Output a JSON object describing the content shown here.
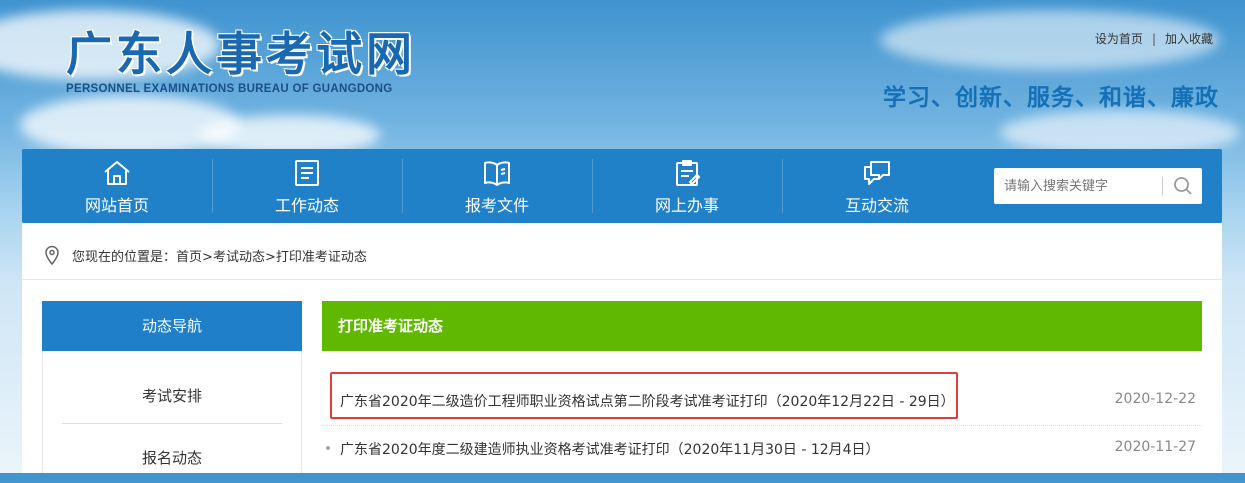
{
  "header": {
    "site_title": "广东人事考试网",
    "site_subtitle": "PERSONNEL EXAMINATIONS BUREAU OF GUANGDONG",
    "top_links": [
      "设为首页",
      "加入收藏"
    ],
    "separator": "|",
    "slogan": "学习、创新、服务、和谐、廉政"
  },
  "nav": {
    "items": [
      {
        "label": "网站首页",
        "icon": "home-icon"
      },
      {
        "label": "工作动态",
        "icon": "document-list-icon"
      },
      {
        "label": "报考文件",
        "icon": "open-book-icon"
      },
      {
        "label": "网上办事",
        "icon": "clipboard-icon"
      },
      {
        "label": "互动交流",
        "icon": "chat-bubbles-icon"
      }
    ],
    "search": {
      "placeholder": "请输入搜索关键字",
      "icon": "search-icon"
    }
  },
  "breadcrumb": {
    "prefix": "您现在的位置是：",
    "items": [
      "首页",
      "考试动态",
      "打印准考证动态"
    ],
    "separator": ">"
  },
  "sidebar": {
    "heading": "动态导航",
    "items": [
      "考试安排",
      "报名动态"
    ]
  },
  "main": {
    "heading": "打印准考证动态",
    "news": [
      {
        "title": "广东省2020年二级造价工程师职业资格试点第二阶段考试准考证打印（2020年12月22日 - 29日）",
        "date": "2020-12-22",
        "highlighted": true
      },
      {
        "title": "广东省2020年度二级建造师执业资格考试准考证打印（2020年11月30日 - 12月4日）",
        "date": "2020-11-27",
        "highlighted": false
      }
    ]
  },
  "colors": {
    "nav_bg": "#2080c8",
    "sidebar_head": "#1f7fc9",
    "main_head": "#60b800",
    "highlight": "#e03c3c",
    "title_blue": "#1a68b0"
  }
}
